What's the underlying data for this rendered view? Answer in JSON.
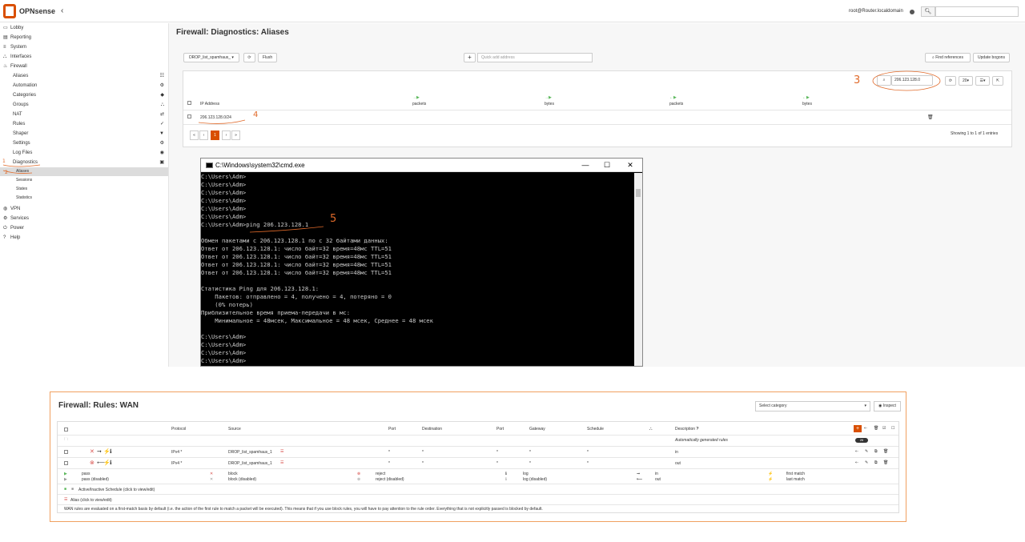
{
  "topbar": {
    "logo_text": "OPNsense",
    "logo_sub": "",
    "collapse_icon": "chevron-left-icon",
    "user": "root@Router.localdomain",
    "search_placeholder": ""
  },
  "sidebar": {
    "items": [
      {
        "label": "Lobby",
        "icon": "laptop-icon",
        "level": 0
      },
      {
        "label": "Reporting",
        "icon": "chart-icon",
        "level": 0
      },
      {
        "label": "System",
        "icon": "server-icon",
        "level": 0
      },
      {
        "label": "Interfaces",
        "icon": "sitemap-icon",
        "level": 0
      },
      {
        "label": "Firewall",
        "icon": "fire-icon",
        "level": 0
      },
      {
        "label": "Aliases",
        "icon": "list-icon",
        "level": 1
      },
      {
        "label": "Automation",
        "icon": "gear-icon",
        "level": 1
      },
      {
        "label": "Categories",
        "icon": "tag-icon",
        "level": 1
      },
      {
        "label": "Groups",
        "icon": "sitemap-icon",
        "level": 1
      },
      {
        "label": "NAT",
        "icon": "exchange-icon",
        "level": 1
      },
      {
        "label": "Rules",
        "icon": "check-icon",
        "level": 1
      },
      {
        "label": "Shaper",
        "icon": "filter-icon",
        "level": 1
      },
      {
        "label": "Settings",
        "icon": "cogs-icon",
        "level": 1
      },
      {
        "label": "Log Files",
        "icon": "eye-icon",
        "level": 1
      },
      {
        "label": "Diagnostics",
        "icon": "medkit-icon",
        "level": 1
      },
      {
        "label": "Aliases",
        "icon": "",
        "level": 2
      },
      {
        "label": "Sessions",
        "icon": "",
        "level": 2
      },
      {
        "label": "States",
        "icon": "",
        "level": 2
      },
      {
        "label": "Statistics",
        "icon": "",
        "level": 2
      },
      {
        "label": "VPN",
        "icon": "globe-icon",
        "level": 0
      },
      {
        "label": "Services",
        "icon": "cog-icon",
        "level": 0
      },
      {
        "label": "Power",
        "icon": "plug-icon",
        "level": 0
      },
      {
        "label": "Help",
        "icon": "help-icon",
        "level": 0
      }
    ]
  },
  "page": {
    "title": "Firewall: Diagnostics: Aliases",
    "alias_select": "DROP_list_spamhaus_",
    "flush": "Flush",
    "quick_add_placeholder": "Quick add address",
    "find_references": "Find references",
    "update_bogons": "Update bogons",
    "search_value": "206.123.128.0",
    "page_size": "20",
    "columns": {
      "ip": "IP Address",
      "in_packets": "packets",
      "in_bytes": "bytes",
      "out_packets": "packets",
      "out_bytes": "bytes"
    },
    "rows": [
      {
        "ip": "206.123.128.0/24"
      }
    ],
    "pager": {
      "first": "«",
      "prev": "‹",
      "current": "1",
      "next": "›",
      "last": "»"
    },
    "showing": "Showing 1 to 1 of 1 entries"
  },
  "cmd": {
    "title": "C:\\Windows\\system32\\cmd.exe",
    "lines": [
      "C:\\Users\\Adm>",
      "C:\\Users\\Adm>",
      "C:\\Users\\Adm>",
      "C:\\Users\\Adm>",
      "C:\\Users\\Adm>",
      "C:\\Users\\Adm>",
      "C:\\Users\\Adm>ping 206.123.128.1",
      "",
      "Обмен пакетами с 206.123.128.1 по с 32 байтами данных:",
      "Ответ от 206.123.128.1: число байт=32 время=48мс TTL=51",
      "Ответ от 206.123.128.1: число байт=32 время=48мс TTL=51",
      "Ответ от 206.123.128.1: число байт=32 время=48мс TTL=51",
      "Ответ от 206.123.128.1: число байт=32 время=48мс TTL=51",
      "",
      "Статистика Ping для 206.123.128.1:",
      "    Пакетов: отправлено = 4, получено = 4, потеряно = 0",
      "    (0% потерь)",
      "Приблизительное время приема-передачи в мс:",
      "    Минимальное = 48мсек, Максимальное = 48 мсек, Среднее = 48 мсек",
      "",
      "C:\\Users\\Adm>",
      "C:\\Users\\Adm>",
      "C:\\Users\\Adm>",
      "C:\\Users\\Adm>"
    ]
  },
  "rules": {
    "title": "Firewall: Rules: WAN",
    "select_category": "Select category",
    "inspect": "Inspect",
    "headers": {
      "protocol": "Protocol",
      "source": "Source",
      "port": "Port",
      "destination": "Destination",
      "port2": "Port",
      "gateway": "Gateway",
      "schedule": "Schedule",
      "description": "Description"
    },
    "auto_rules": "Automatically generated rules",
    "auto_count": "26",
    "rows": [
      {
        "protocol": "IPv4 *",
        "source": "DROP_list_spamhaus_1",
        "port": "*",
        "destination": "*",
        "port2": "*",
        "gateway": "*",
        "schedule": "*",
        "description": "in"
      },
      {
        "protocol": "IPv4 *",
        "source": "DROP_list_spamhaus_1",
        "port": "*",
        "destination": "*",
        "port2": "*",
        "gateway": "*",
        "schedule": "*",
        "description": "out"
      }
    ],
    "legend": {
      "pass": "pass",
      "pass_disabled": "pass (disabled)",
      "block": "block",
      "block_disabled": "block (disabled)",
      "reject": "reject",
      "reject_disabled": "reject (disabled)",
      "log": "log",
      "log_disabled": "log (disabled)",
      "in": "in",
      "out": "out",
      "first_match": "first match",
      "last_match": "last match",
      "schedule": "Active/Inactive Schedule (click to view/edit)",
      "alias": "Alias (click to view/edit)",
      "note": "WAN rules are evaluated on a first-match basis by default (i.e. the action of the first rule to match a packet will be executed). This means that if you use block rules, you will have to pay attention to the rule order. Everything that is not explicitly passed is blocked by default."
    }
  },
  "annotations": [
    "1",
    "2",
    "3",
    "4",
    "5"
  ],
  "colors": {
    "accent": "#d94f00",
    "annotation": "#e06a2a",
    "green": "#5cb85c",
    "red": "#d9534f"
  }
}
